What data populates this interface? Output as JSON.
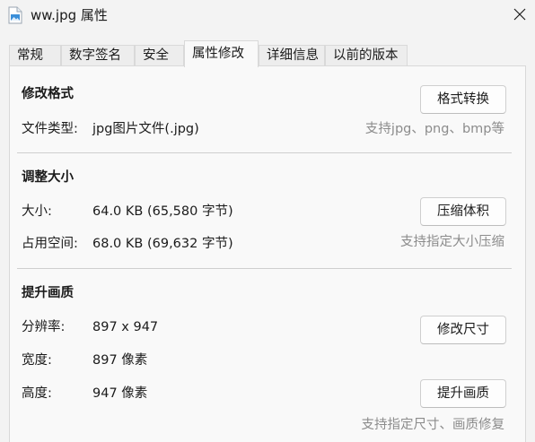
{
  "window": {
    "title": "ww.jpg 属性"
  },
  "tabs": [
    {
      "label": "常规"
    },
    {
      "label": "数字签名"
    },
    {
      "label": "安全"
    },
    {
      "label": "属性修改"
    },
    {
      "label": "详细信息"
    },
    {
      "label": "以前的版本"
    }
  ],
  "active_tab": "属性修改",
  "format": {
    "title": "修改格式",
    "file_type_label": "文件类型:",
    "file_type_value": "jpg图片文件(.jpg)",
    "convert_button": "格式转换",
    "hint": "支持jpg、png、bmp等"
  },
  "size": {
    "title": "调整大小",
    "size_label": "大小:",
    "size_value": "64.0 KB (65,580 字节)",
    "disk_label": "占用空间:",
    "disk_value": "68.0 KB (69,632 字节)",
    "compress_button": "压缩体积",
    "hint": "支持指定大小压缩"
  },
  "quality": {
    "title": "提升画质",
    "resolution_label": "分辨率:",
    "resolution_value": "897 x 947",
    "width_label": "宽度:",
    "width_value": "897 像素",
    "height_label": "高度:",
    "height_value": "947 像素",
    "resize_button": "修改尺寸",
    "enhance_button": "提升画质",
    "hint": "支持指定尺寸、画质修复"
  },
  "icons": {
    "file": "image-file-icon",
    "close": "close-icon"
  }
}
